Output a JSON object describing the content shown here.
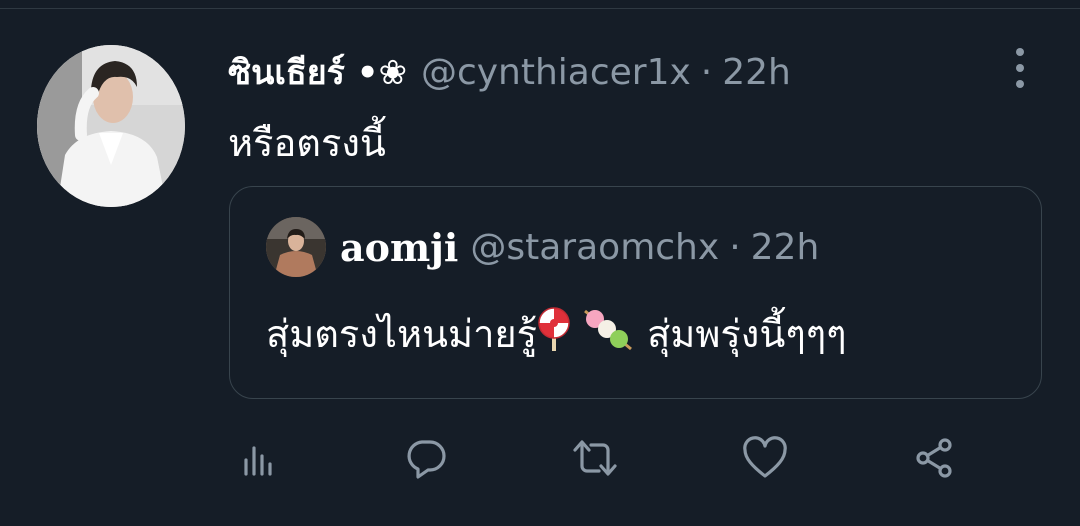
{
  "tweet": {
    "author_name": "ซินเธียร์ •❀",
    "author_handle": "@cynthiacer1x",
    "separator": "·",
    "time": "22h",
    "text": "หรือตรงนี้"
  },
  "quoted_tweet": {
    "author_name": "aomji",
    "author_handle": "@staraomchx",
    "separator": "·",
    "time": "22h",
    "text_part1": "สุ่มตรงไหนม่ายรู้",
    "emoji_1": "lollipop",
    "emoji_2": "dango",
    "text_part2": "สุ่มพรุ่งนี้ๆๆๆ"
  },
  "actions": [
    "analytics-icon",
    "reply-icon",
    "retweet-icon",
    "like-icon",
    "share-icon"
  ],
  "colors": {
    "background": "#151d27",
    "text_primary": "#ffffff",
    "text_secondary": "#8b98a5",
    "border": "#38444d"
  }
}
